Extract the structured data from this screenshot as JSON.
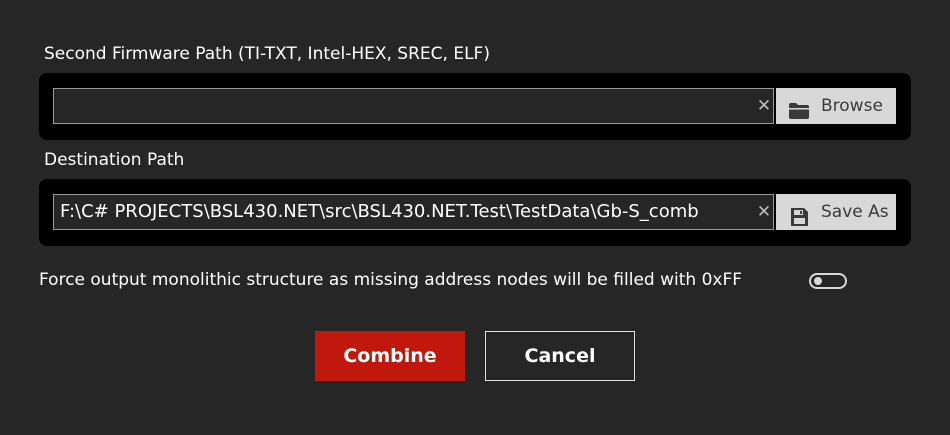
{
  "second_firmware": {
    "label": "Second Firmware Path (TI-TXT, Intel-HEX, SREC, ELF)",
    "value": "",
    "clear_glyph": "✕",
    "browse_label": "Browse",
    "browse_icon": "folder-icon"
  },
  "destination": {
    "label": "Destination Path",
    "value": "F:\\C# PROJECTS\\BSL430.NET\\src\\BSL430.NET.Test\\TestData\\Gb-S_comb",
    "clear_glyph": "✕",
    "save_label": "Save As",
    "save_icon": "floppy-disk-icon"
  },
  "monolithic": {
    "label": "Force output monolithic structure as missing address nodes will be filled with 0xFF",
    "enabled": false
  },
  "actions": {
    "combine_label": "Combine",
    "cancel_label": "Cancel"
  },
  "colors": {
    "background": "#262626",
    "panel": "#000000",
    "accent": "#c0180c",
    "button_face": "#d8d8d8"
  }
}
